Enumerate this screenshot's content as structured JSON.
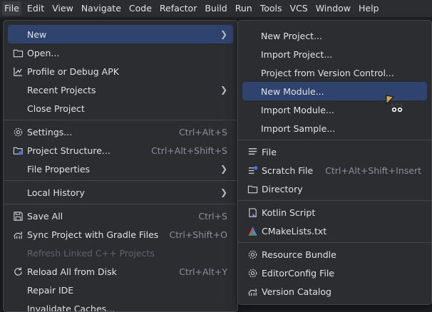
{
  "menubar": {
    "items": [
      {
        "label": "File",
        "active": true
      },
      {
        "label": "Edit"
      },
      {
        "label": "View"
      },
      {
        "label": "Navigate"
      },
      {
        "label": "Code"
      },
      {
        "label": "Refactor"
      },
      {
        "label": "Build"
      },
      {
        "label": "Run"
      },
      {
        "label": "Tools"
      },
      {
        "label": "VCS"
      },
      {
        "label": "Window"
      },
      {
        "label": "Help"
      }
    ]
  },
  "file_menu": {
    "new": "New",
    "open": "Open...",
    "profile_debug_apk": "Profile or Debug APK",
    "recent_projects": "Recent Projects",
    "close_project": "Close Project",
    "settings": "Settings...",
    "settings_shortcut": "Ctrl+Alt+S",
    "project_structure": "Project Structure...",
    "project_structure_shortcut": "Ctrl+Alt+Shift+S",
    "file_properties": "File Properties",
    "local_history": "Local History",
    "save_all": "Save All",
    "save_all_shortcut": "Ctrl+S",
    "sync_gradle": "Sync Project with Gradle Files",
    "sync_gradle_shortcut": "Ctrl+Shift+O",
    "refresh_cpp": "Refresh Linked C++ Projects",
    "reload_disk": "Reload All from Disk",
    "reload_disk_shortcut": "Ctrl+Alt+Y",
    "repair_ide": "Repair IDE",
    "invalidate_caches": "Invalidate Caches..."
  },
  "new_submenu": {
    "new_project": "New Project...",
    "import_project": "Import Project...",
    "project_from_vcs": "Project from Version Control...",
    "new_module": "New Module...",
    "import_module": "Import Module...",
    "import_sample": "Import Sample...",
    "file": "File",
    "scratch_file": "Scratch File",
    "scratch_file_shortcut": "Ctrl+Alt+Shift+Insert",
    "directory": "Directory",
    "kotlin_script": "Kotlin Script",
    "cmakelists": "CMakeLists.txt",
    "resource_bundle": "Resource Bundle",
    "editorconfig": "EditorConfig File",
    "version_catalog": "Version Catalog"
  },
  "colors": {
    "selection": "#2e436e",
    "menu_bg": "#2b2d30",
    "text": "#dfe1e5",
    "shortcut": "#8c8f95",
    "disabled": "#5f6267"
  }
}
